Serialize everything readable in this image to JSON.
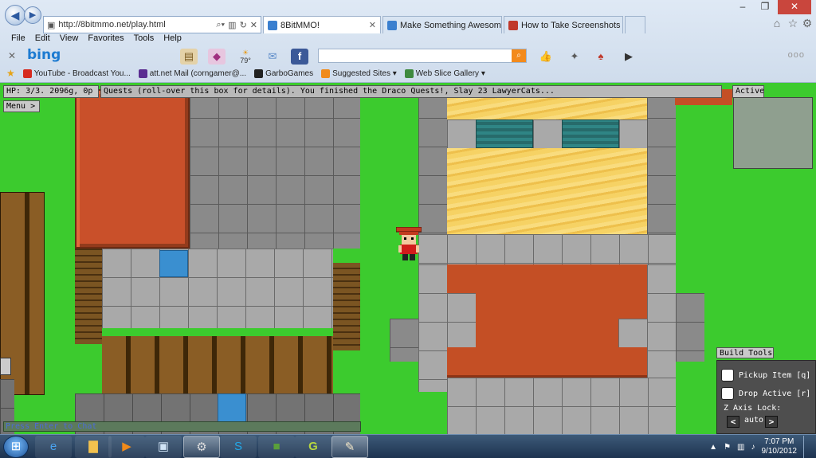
{
  "browser": {
    "url": "http://8bitmmo.net/play.html",
    "tabs": [
      {
        "label": "8BitMMO!",
        "active": true
      },
      {
        "label": "Make Something Awesome Co...",
        "active": false
      },
      {
        "label": "How to Take Screenshots in Wi...",
        "active": false
      }
    ],
    "menu": [
      "File",
      "Edit",
      "View",
      "Favorites",
      "Tools",
      "Help"
    ],
    "bing_logo": "bing",
    "weather_temp": "79°",
    "favorites": [
      {
        "label": "YouTube - Broadcast You...",
        "color": "#d62b20"
      },
      {
        "label": "att.net Mail (corngamer@...",
        "color": "#5a2d91"
      },
      {
        "label": "GarboGames",
        "color": "#222222"
      },
      {
        "label": "Suggested Sites ▾",
        "color": "#f08a1a"
      },
      {
        "label": "Web Slice Gallery ▾",
        "color": "#3f8a3f"
      }
    ]
  },
  "game": {
    "hud_status": "HP: 3/3.  2096g, 0p",
    "hud_quests": "Quests (roll-over this box for details). You finished the Draco Quests!, Slay 23 LawyerCats...",
    "hud_active": "Active",
    "menu_label": "Menu >",
    "build_tools": {
      "title": "Build Tools",
      "pickup": "Pickup Item [q]",
      "drop": "Drop Active [r]",
      "zlock_label": "Z Axis Lock:",
      "zlock_value": "auto",
      "prev": "<",
      "next": ">"
    },
    "chat_placeholder": "Press Enter to Chat"
  },
  "taskbar": {
    "start_icon": "windows-orb-icon",
    "apps": [
      "internet-explorer-icon",
      "file-explorer-icon",
      "media-player-icon",
      "screen-icon",
      "steam-icon",
      "skype-icon",
      "minecraft-icon",
      "g-app-icon",
      "paint-icon"
    ],
    "time": "7:07 PM",
    "date": "9/10/2012"
  }
}
